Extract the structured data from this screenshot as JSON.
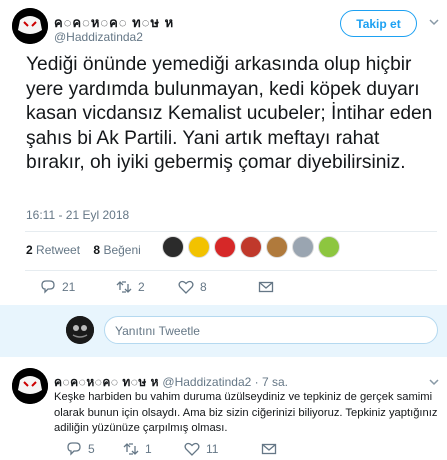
{
  "tweet": {
    "display_name": "ค◌ค◌ห◌ค◌ ท◌ษ ห",
    "handle": "@Haddizatinda2",
    "follow_label": "Takip et",
    "text": "Yediği önünde yemediği arkasında olup hiçbir yere yardımda bulunmayan, kedi köpek duyarı kasan vicdansız Kemalist ucubeler; İntihar eden şahıs bi Ak Partili. Yani artık meftayı rahat bırakır, oh iyiki gebermiş çomar diyebilirsiniz.",
    "timestamp": "16:11 - 21 Eyl 2018",
    "retweet_count": "2",
    "retweet_label": "Retweet",
    "like_count": "8",
    "like_label": "Beğeni",
    "likers": [
      "#2b2b2b",
      "#f2c200",
      "#d62828",
      "#c0392b",
      "#b07a3c",
      "#9aa5b1",
      "#8dc63f"
    ],
    "actions": {
      "reply_count": "21",
      "retweet_count": "2",
      "like_count": "8"
    }
  },
  "reply_box": {
    "placeholder": "Yanıtını Tweetle"
  },
  "reply": {
    "display_name": "ค◌ค◌ห◌ค◌ ท◌ษ ห",
    "handle": "@Haddizatinda2",
    "separator": " · ",
    "time": "7 sa.",
    "text": "Keşke harbiden bu vahim duruma üzülseydiniz ve tepkiniz de gerçek samimi olarak bunun için olsaydı. Ama biz sizin ciğerinizi biliyoruz. Tepkiniz yaptığınız adiliğin yüzünüze çarpılmış olması.",
    "actions": {
      "reply_count": "5",
      "retweet_count": "1",
      "like_count": "11"
    }
  },
  "colors": {
    "accent": "#1da1f2",
    "muted": "#657786",
    "divider": "#e6ecf0"
  }
}
